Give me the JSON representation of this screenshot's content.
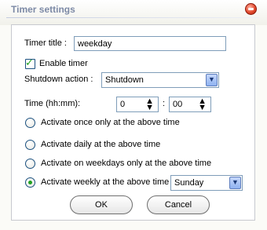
{
  "window": {
    "title": "Timer settings"
  },
  "form": {
    "timer_title_label": "Timer title :",
    "timer_title_value": "weekday",
    "enable_timer_label": "Enable timer",
    "enable_timer_checked": true,
    "shutdown_action_label": "Shutdown action :",
    "shutdown_action_value": "Shutdown",
    "time_label": "Time (hh:mm):",
    "time_hours": "0",
    "time_separator": ":",
    "time_minutes": "00"
  },
  "options": [
    {
      "label": "Activate once only at the above time",
      "selected": false
    },
    {
      "label": "Activate daily at the above time",
      "selected": false
    },
    {
      "label": "Activate on weekdays only at the above time",
      "selected": false
    },
    {
      "label": "Activate weekly at the above time",
      "selected": true
    }
  ],
  "weekday_select": {
    "value": "Sunday"
  },
  "buttons": {
    "ok": "OK",
    "cancel": "Cancel"
  },
  "icons": {
    "close": "close-icon",
    "check": "check-icon",
    "dropdown": "chevron-down-icon",
    "spinner": "spinner-arrows-icon"
  },
  "colors": {
    "title_text": "#7d8aa6",
    "accent_green": "#21a121",
    "close_red": "#e34a2e"
  }
}
